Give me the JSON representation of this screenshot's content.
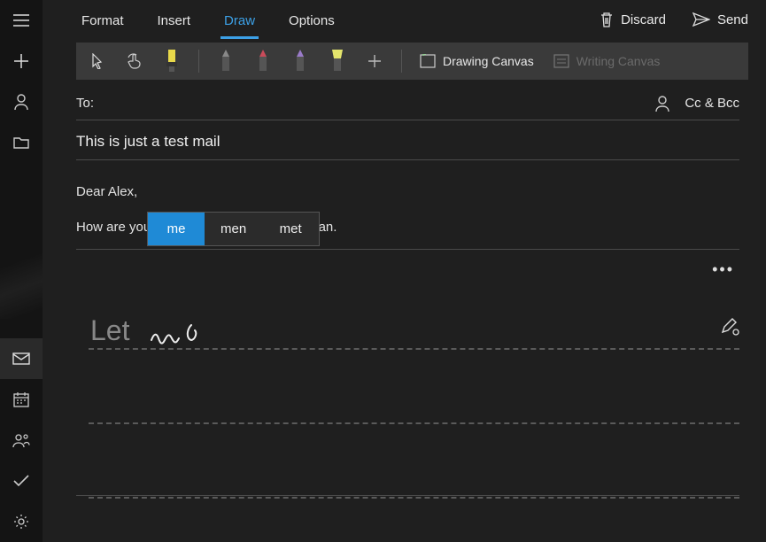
{
  "menu": {
    "format": "Format",
    "insert": "Insert",
    "draw": "Draw",
    "options": "Options",
    "discard": "Discard",
    "send": "Send"
  },
  "toolbar": {
    "drawing_canvas": "Drawing Canvas",
    "writing_canvas": "Writing Canvas"
  },
  "to": {
    "label": "To:",
    "cc_bcc": "Cc & Bcc"
  },
  "subject": "This is just a test mail",
  "body": {
    "line1": "Dear Alex,",
    "line2": "How are you",
    "line2_after": "ess plan."
  },
  "suggestions": {
    "s1": "me",
    "s2": "men",
    "s3": "met"
  },
  "writing": {
    "recognized": "Let"
  }
}
